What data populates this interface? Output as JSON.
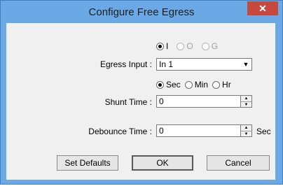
{
  "window": {
    "title": "Configure Free Egress",
    "close_symbol": "✕"
  },
  "egress_type": {
    "options": [
      {
        "label": "I",
        "checked": true,
        "enabled": true
      },
      {
        "label": "O",
        "checked": false,
        "enabled": false
      },
      {
        "label": "G",
        "checked": false,
        "enabled": false
      }
    ]
  },
  "egress_input": {
    "label": "Egress Input :",
    "value": "In 1"
  },
  "time_unit": {
    "options": [
      {
        "label": "Sec",
        "checked": true
      },
      {
        "label": "Min",
        "checked": false
      },
      {
        "label": "Hr",
        "checked": false
      }
    ]
  },
  "shunt_time": {
    "label": "Shunt Time :",
    "value": "0"
  },
  "debounce_time": {
    "label": "Debounce Time :",
    "value": "0",
    "unit": "Sec"
  },
  "buttons": {
    "set_defaults": "Set Defaults",
    "ok": "OK",
    "cancel": "Cancel"
  }
}
